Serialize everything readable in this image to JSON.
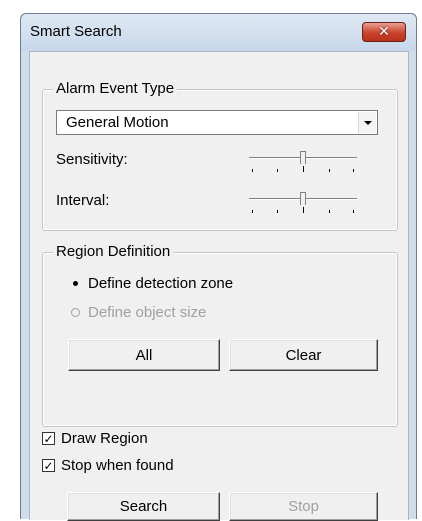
{
  "window": {
    "title": "Smart Search",
    "close_glyph": "✕"
  },
  "alarm_group": {
    "legend": "Alarm Event Type",
    "event_type": {
      "selected": "General Motion"
    },
    "sensitivity": {
      "label": "Sensitivity:",
      "level": 0.5
    },
    "interval": {
      "label": "Interval:",
      "level": 0.5
    }
  },
  "region_group": {
    "legend": "Region Definition",
    "options": [
      {
        "label": "Define detection zone",
        "selected": true,
        "enabled": true
      },
      {
        "label": "Define object size",
        "selected": false,
        "enabled": false
      }
    ],
    "all_label": "All",
    "clear_label": "Clear"
  },
  "draw_region": {
    "label": "Draw Region",
    "checked": true
  },
  "stop_when_found": {
    "label": "Stop when found",
    "checked": true
  },
  "actions": {
    "search_label": "Search",
    "stop_label": "Stop",
    "stop_enabled": false
  },
  "colors": {
    "titlebar": "#cfdcea",
    "close_button": "#c8432d",
    "dialog_background": "#f0f0f0",
    "disabled_text": "#a0a0a0"
  }
}
